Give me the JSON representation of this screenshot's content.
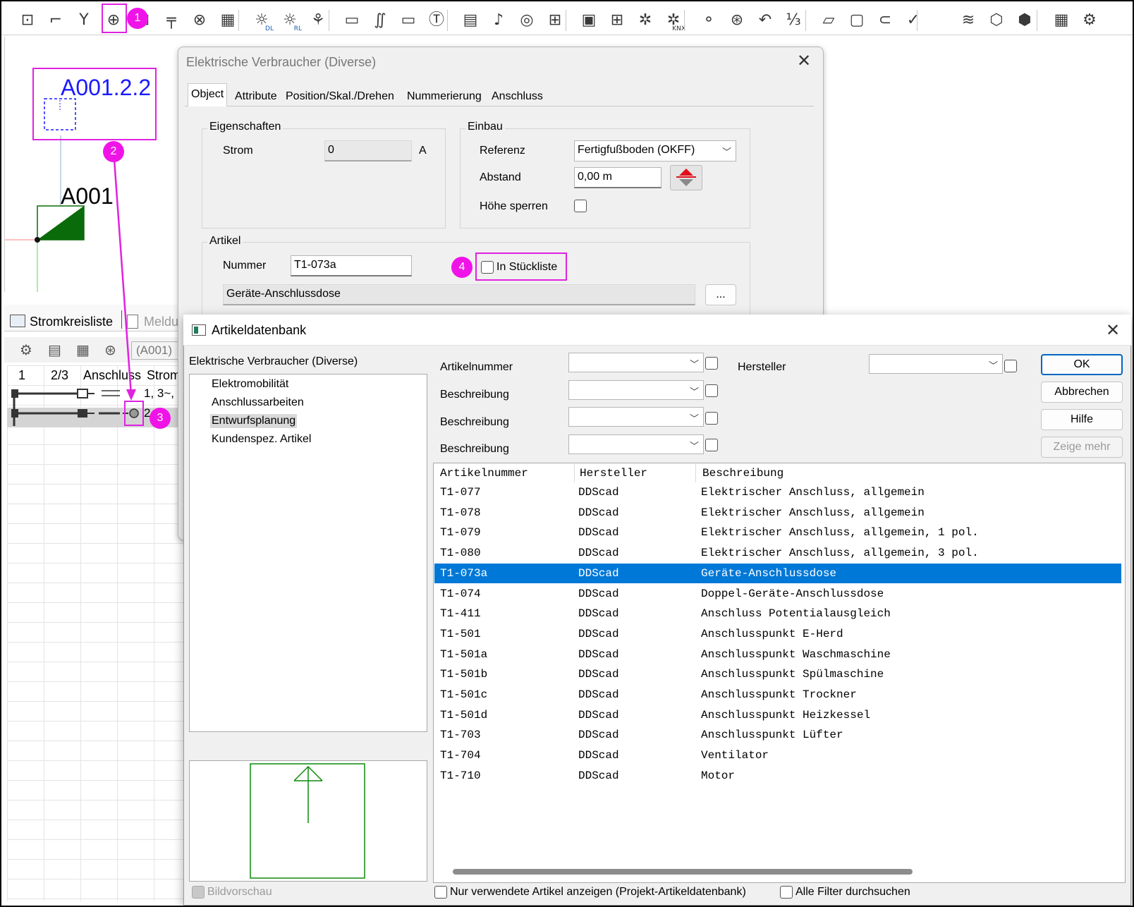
{
  "toolbar": {
    "icons": [
      "cable-tray-icon",
      "branch-icon",
      "junction-icon",
      "connection-point-icon",
      "distribution-icon",
      "socket-icon",
      "cross-circle-icon",
      "panel-icon",
      "light-dl-icon",
      "light-rl-icon",
      "sensor-icon",
      "device-icon",
      "signal-icon",
      "terminal-icon",
      "t-circle-icon",
      "intercom-icon",
      "bell-icon",
      "speaker-icon",
      "outlet-box-icon",
      "frame-icon",
      "network-box-icon",
      "network-icon",
      "knx-icon",
      "bus-icon",
      "hub-icon",
      "address-icon",
      "numbering-icon",
      "tray-icon",
      "box-icon",
      "pipe-icon",
      "check-icon",
      "cable-route-icon",
      "cube-icon",
      "view-icon",
      "solar-icon",
      "more-icon"
    ],
    "glyphs": [
      "⊡",
      "⌐",
      "Y",
      "⊕",
      "⊞",
      "╤",
      "⊗",
      "▦",
      "☼",
      "☼",
      "⚘",
      "▭",
      "∬",
      "▭",
      "Ⓣ",
      "▤",
      "♪",
      "◎",
      "⊞",
      "▣",
      "⊞",
      "✲",
      "✲",
      "⚬",
      "⊛",
      "↶",
      "⅓",
      "▱",
      "▢",
      "⊂",
      "✓",
      "≋",
      "⬡",
      "⬢",
      "▦",
      "⚙"
    ],
    "knx_label": "KNX",
    "dl_label": "DL",
    "rl_label": "RL"
  },
  "badges": {
    "b1": "1",
    "b2": "2",
    "b3": "3",
    "b4": "4"
  },
  "cad": {
    "label_top": "A001.2.2",
    "label_main": "A001"
  },
  "panel": {
    "tab1": "Stromkreisliste",
    "tab2": "Meldu",
    "filter": "(A001)",
    "headers": [
      "1",
      "2/3",
      "Anschluss",
      "Strom"
    ],
    "row1_text": "1, 3~,",
    "row2_text": "2,"
  },
  "dlg1": {
    "title": "Elektrische Verbraucher (Diverse)",
    "tabs": [
      "Object",
      "Attribute",
      "Position/Skal./Drehen",
      "Nummerierung",
      "Anschluss"
    ],
    "eigenschaften": {
      "group": "Eigenschaften",
      "strom_label": "Strom",
      "strom_value": "0",
      "strom_unit": "A"
    },
    "einbau": {
      "group": "Einbau",
      "referenz_label": "Referenz",
      "referenz_value": "Fertigfußboden (OKFF)",
      "abstand_label": "Abstand",
      "abstand_value": "0,00 m",
      "hoehe_label": "Höhe sperren"
    },
    "artikel": {
      "group": "Artikel",
      "nummer_label": "Nummer",
      "nummer_value": "T1-073a",
      "stueckliste_label": "In Stückliste",
      "description": "Geräte-Anschlussdose",
      "browse": "..."
    }
  },
  "dlg2": {
    "title": "Artikeldatenbank",
    "tree_title": "Elektrische Verbraucher (Diverse)",
    "tree": [
      {
        "label": "Elektromobilität",
        "selected": false
      },
      {
        "label": "Anschlussarbeiten",
        "selected": false
      },
      {
        "label": "Entwurfsplanung",
        "selected": true
      },
      {
        "label": "Kundenspez. Artikel",
        "selected": false
      }
    ],
    "filters": {
      "artikelnummer": "Artikelnummer",
      "beschreibung": "Beschreibung",
      "hersteller": "Hersteller"
    },
    "buttons": {
      "ok": "OK",
      "cancel": "Abbrechen",
      "help": "Hilfe",
      "more": "Zeige mehr"
    },
    "columns": [
      "Artikelnummer",
      "Hersteller",
      "Beschreibung"
    ],
    "rows": [
      {
        "nr": "T1-077",
        "hersteller": "DDScad",
        "beschreibung": "Elektrischer Anschluss, allgemein"
      },
      {
        "nr": "T1-078",
        "hersteller": "DDScad",
        "beschreibung": "Elektrischer Anschluss, allgemein"
      },
      {
        "nr": "T1-079",
        "hersteller": "DDScad",
        "beschreibung": "Elektrischer Anschluss, allgemein, 1 pol."
      },
      {
        "nr": "T1-080",
        "hersteller": "DDScad",
        "beschreibung": "Elektrischer Anschluss, allgemein, 3 pol."
      },
      {
        "nr": "T1-073a",
        "hersteller": "DDScad",
        "beschreibung": "Geräte-Anschlussdose",
        "selected": true
      },
      {
        "nr": "T1-074",
        "hersteller": "DDScad",
        "beschreibung": "Doppel-Geräte-Anschlussdose"
      },
      {
        "nr": "T1-411",
        "hersteller": "DDScad",
        "beschreibung": "Anschluss Potentialausgleich"
      },
      {
        "nr": "T1-501",
        "hersteller": "DDScad",
        "beschreibung": "Anschlusspunkt E-Herd"
      },
      {
        "nr": "T1-501a",
        "hersteller": "DDScad",
        "beschreibung": "Anschlusspunkt Waschmaschine"
      },
      {
        "nr": "T1-501b",
        "hersteller": "DDScad",
        "beschreibung": "Anschlusspunkt Spülmaschine"
      },
      {
        "nr": "T1-501c",
        "hersteller": "DDScad",
        "beschreibung": "Anschlusspunkt Trockner"
      },
      {
        "nr": "T1-501d",
        "hersteller": "DDScad",
        "beschreibung": "Anschlusspunkt Heizkessel"
      },
      {
        "nr": "T1-703",
        "hersteller": "DDScad",
        "beschreibung": "Anschlusspunkt Lüfter"
      },
      {
        "nr": "T1-704",
        "hersteller": "DDScad",
        "beschreibung": "Ventilator"
      },
      {
        "nr": "T1-710",
        "hersteller": "DDScad",
        "beschreibung": "Motor"
      }
    ],
    "preview_label": "Bildvorschau",
    "only_used_label": "Nur verwendete Artikel anzeigen (Projekt-Artikeldatenbank)",
    "all_filters_label": "Alle Filter durchsuchen"
  },
  "colors": {
    "annotation": "#e022e0",
    "badge": "#f013e8",
    "selection": "#0078d7",
    "cad_label": "#1a1aff",
    "symbol_green": "#0a6b0a"
  }
}
